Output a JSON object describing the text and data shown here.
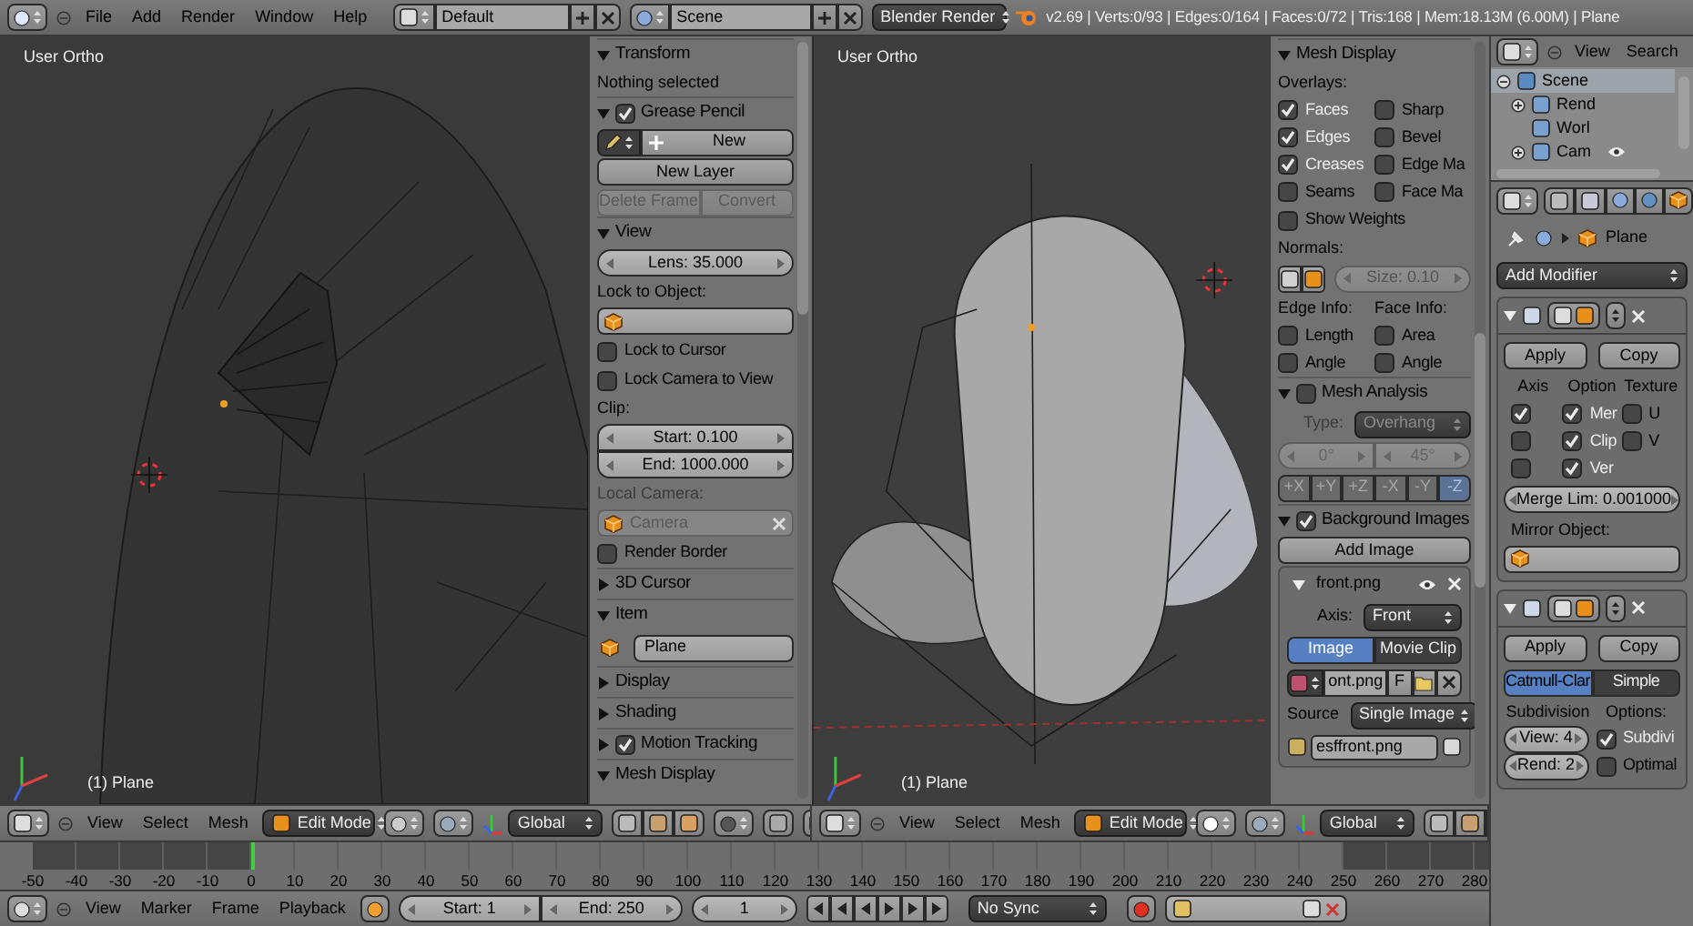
{
  "top_bar": {
    "menus": [
      "File",
      "Add",
      "Render",
      "Window",
      "Help"
    ],
    "layout": "Default",
    "scene": "Scene",
    "engine": "Blender Render",
    "stats": "v2.69 | Verts:0/93 | Edges:0/164 | Faces:0/72 | Tris:168 | Mem:18.13M (6.00M) | Plane"
  },
  "viewports": [
    {
      "view": "User Ortho",
      "object": "(1) Plane"
    },
    {
      "view": "User Ortho",
      "object": "(1) Plane"
    }
  ],
  "left_panel": {
    "rows": [
      {
        "kind": "header",
        "label": "Transform",
        "expanded": true
      },
      {
        "kind": "label",
        "text": "Nothing selected"
      },
      {
        "kind": "header",
        "label": "Grease Pencil",
        "expanded": true,
        "checked": true
      },
      {
        "kind": "new_row",
        "label": "New"
      },
      {
        "kind": "button",
        "label": "New Layer"
      },
      {
        "kind": "buttons",
        "items": [
          {
            "label": "Delete Frame",
            "disabled": true
          },
          {
            "label": "Convert",
            "disabled": true
          }
        ]
      },
      {
        "kind": "header",
        "label": "View",
        "expanded": true
      },
      {
        "kind": "number_column",
        "items": [
          "Lens: 35.000"
        ]
      },
      {
        "kind": "label",
        "text": "Lock to Object:"
      },
      {
        "kind": "object_field"
      },
      {
        "kind": "checkbox",
        "label": "Lock to Cursor",
        "checked": false
      },
      {
        "kind": "checkbox",
        "label": "Lock Camera to View",
        "checked": false
      },
      {
        "kind": "label",
        "text": "Clip:"
      },
      {
        "kind": "number_column",
        "items": [
          "Start: 0.100",
          "End: 1000.000"
        ]
      },
      {
        "kind": "label",
        "text": "Local Camera:",
        "disabled": true
      },
      {
        "kind": "object_field",
        "value": "Camera",
        "disabled": true,
        "clear": true
      },
      {
        "kind": "checkbox",
        "label": "Render Border",
        "checked": false
      },
      {
        "kind": "header",
        "label": "3D Cursor",
        "expanded": false
      },
      {
        "kind": "header",
        "label": "Item",
        "expanded": true
      },
      {
        "kind": "item_field",
        "value": "Plane"
      },
      {
        "kind": "header",
        "label": "Display",
        "expanded": false
      },
      {
        "kind": "header",
        "label": "Shading",
        "expanded": false
      },
      {
        "kind": "header",
        "label": "Motion Tracking",
        "expanded": false,
        "checked": true
      },
      {
        "kind": "header",
        "label": "Mesh Display",
        "expanded": true
      }
    ]
  },
  "right_panel": {
    "rows": [
      {
        "kind": "header",
        "label": "Mesh Display",
        "expanded": true
      },
      {
        "kind": "label",
        "text": "Overlays:"
      },
      {
        "kind": "check_row",
        "items": [
          {
            "label": "Faces",
            "checked": true
          },
          {
            "label": "Sharp",
            "checked": false
          }
        ]
      },
      {
        "kind": "check_row",
        "items": [
          {
            "label": "Edges",
            "checked": true
          },
          {
            "label": "Bevel",
            "checked": false
          }
        ]
      },
      {
        "kind": "check_row",
        "items": [
          {
            "label": "Creases",
            "checked": true
          },
          {
            "label": "Edge Ma",
            "checked": false
          }
        ]
      },
      {
        "kind": "check_row",
        "items": [
          {
            "label": "Seams",
            "checked": false
          },
          {
            "label": "Face Ma",
            "checked": false
          }
        ]
      },
      {
        "kind": "checkbox",
        "label": "Show Weights",
        "checked": false
      },
      {
        "kind": "label",
        "text": "Normals:"
      },
      {
        "kind": "normals",
        "size": "Size: 0.10"
      },
      {
        "kind": "labels",
        "items": [
          "Edge Info:",
          "Face Info:"
        ]
      },
      {
        "kind": "check_row",
        "items": [
          {
            "label": "Length",
            "checked": false
          },
          {
            "label": "Area",
            "checked": false
          }
        ]
      },
      {
        "kind": "check_row",
        "items": [
          {
            "label": "Angle",
            "checked": false
          },
          {
            "label": "Angle",
            "checked": false
          }
        ]
      },
      {
        "kind": "header",
        "label": "Mesh Analysis",
        "expanded": true,
        "checked": false
      },
      {
        "kind": "select",
        "label": "Type:",
        "value": "Overhang",
        "disabled": true
      },
      {
        "kind": "number_row",
        "items": [
          "0°",
          "45°"
        ],
        "disabled": true
      },
      {
        "kind": "toggles",
        "disabled": true,
        "items": [
          {
            "label": "+X",
            "selected": false
          },
          {
            "label": "+Y",
            "selected": false
          },
          {
            "label": "+Z",
            "selected": false
          },
          {
            "label": "-X",
            "selected": false
          },
          {
            "label": "-Y",
            "selected": false
          },
          {
            "label": "-Z",
            "selected": true
          }
        ]
      },
      {
        "kind": "header",
        "label": "Background Images",
        "expanded": true,
        "checked": true
      },
      {
        "kind": "button",
        "label": "Add Image"
      },
      {
        "kind": "box",
        "rows": [
          {
            "kind": "subheader",
            "label": "front.png",
            "expanded": true
          },
          {
            "kind": "select",
            "label": "Axis:",
            "value": "Front"
          },
          {
            "kind": "toggles",
            "items": [
              {
                "label": "Image",
                "selected": true
              },
              {
                "label": "Movie Clip",
                "selected": false
              }
            ]
          },
          {
            "kind": "image_row",
            "value": "ont.png",
            "flag": "F"
          },
          {
            "kind": "select",
            "label": "Source",
            "value": "Single Image"
          },
          {
            "kind": "file_row",
            "value": "esffront.png"
          }
        ]
      }
    ]
  },
  "view_headers": [
    {
      "menus": [
        "View",
        "Select",
        "Mesh"
      ],
      "mode": "Edit Mode",
      "orientation": "Global"
    },
    {
      "menus": [
        "View",
        "Select",
        "Mesh"
      ],
      "mode": "Edit Mode",
      "orientation": "Global"
    }
  ],
  "timeline": {
    "ticks": [
      {
        "label": "-50",
        "in_range": false,
        "current": false
      },
      {
        "label": "-40",
        "in_range": false,
        "current": false
      },
      {
        "label": "-30",
        "in_range": false,
        "current": false
      },
      {
        "label": "-20",
        "in_range": false,
        "current": false
      },
      {
        "label": "-10",
        "in_range": false,
        "current": false
      },
      {
        "label": "0",
        "in_range": true,
        "current": true
      },
      {
        "label": "10",
        "in_range": true,
        "current": false
      },
      {
        "label": "20",
        "in_range": true,
        "current": false
      },
      {
        "label": "30",
        "in_range": true,
        "current": false
      },
      {
        "label": "40",
        "in_range": true,
        "current": false
      },
      {
        "label": "50",
        "in_range": true,
        "current": false
      },
      {
        "label": "60",
        "in_range": true,
        "current": false
      },
      {
        "label": "70",
        "in_range": true,
        "current": false
      },
      {
        "label": "80",
        "in_range": true,
        "current": false
      },
      {
        "label": "90",
        "in_range": true,
        "current": false
      },
      {
        "label": "100",
        "in_range": true,
        "current": false
      },
      {
        "label": "110",
        "in_range": true,
        "current": false
      },
      {
        "label": "120",
        "in_range": true,
        "current": false
      },
      {
        "label": "130",
        "in_range": true,
        "current": false
      },
      {
        "label": "140",
        "in_range": true,
        "current": false
      },
      {
        "label": "150",
        "in_range": true,
        "current": false
      },
      {
        "label": "160",
        "in_range": true,
        "current": false
      },
      {
        "label": "170",
        "in_range": true,
        "current": false
      },
      {
        "label": "180",
        "in_range": true,
        "current": false
      },
      {
        "label": "190",
        "in_range": true,
        "current": false
      },
      {
        "label": "200",
        "in_range": true,
        "current": false
      },
      {
        "label": "210",
        "in_range": true,
        "current": false
      },
      {
        "label": "220",
        "in_range": true,
        "current": false
      },
      {
        "label": "230",
        "in_range": true,
        "current": false
      },
      {
        "label": "240",
        "in_range": true,
        "current": false
      },
      {
        "label": "250",
        "in_range": false,
        "current": false
      },
      {
        "label": "260",
        "in_range": false,
        "current": false
      },
      {
        "label": "270",
        "in_range": false,
        "current": false
      },
      {
        "label": "280",
        "in_range": false,
        "current": false
      }
    ],
    "menus": [
      "View",
      "Marker",
      "Frame",
      "Playback"
    ],
    "start": "Start: 1",
    "end": "End: 250",
    "frame": "1",
    "sync": "No Sync"
  },
  "outliner": {
    "menus": [
      "View",
      "Search"
    ],
    "tree": [
      {
        "label": "Scene",
        "expanded": true,
        "selected": true,
        "children": [
          {
            "label": "Rend",
            "expanded": false,
            "selected": false
          },
          {
            "label": "Worl",
            "selected": false
          },
          {
            "label": "Cam",
            "expanded": false,
            "selected": false,
            "visible": true
          }
        ]
      }
    ]
  },
  "properties": {
    "object": "Plane",
    "add_modifier": "Add Modifier",
    "modifiers": [
      {
        "kind": "mirror",
        "expanded": true,
        "apply": "Apply",
        "copy": "Copy",
        "headings": [
          "Axis",
          "Option",
          "Texture"
        ],
        "check_rows": [
          [
            {
              "checked": true
            },
            {
              "label": "Mer",
              "checked": true
            },
            {
              "label": "U",
              "checked": false
            }
          ],
          [
            {
              "checked": false
            },
            {
              "label": "Clip",
              "checked": true
            },
            {
              "label": "V",
              "checked": false
            }
          ],
          [
            {
              "checked": false
            },
            {
              "label": "Ver",
              "checked": true
            }
          ]
        ],
        "merge": "Merge Lim: 0.001000",
        "mirror_label": "Mirror Object:"
      },
      {
        "kind": "subsurf",
        "expanded": true,
        "apply": "Apply",
        "copy": "Copy",
        "types": [
          {
            "label": "Catmull-Clar",
            "selected": true
          },
          {
            "label": "Simple",
            "selected": false
          }
        ],
        "headings": [
          "Subdivision",
          "Options:"
        ],
        "levels": [
          "View: 4",
          "Rend: 2"
        ],
        "options": [
          {
            "label": "Subdivi",
            "checked": true
          },
          {
            "label": "Optimal",
            "checked": false
          }
        ]
      }
    ]
  }
}
